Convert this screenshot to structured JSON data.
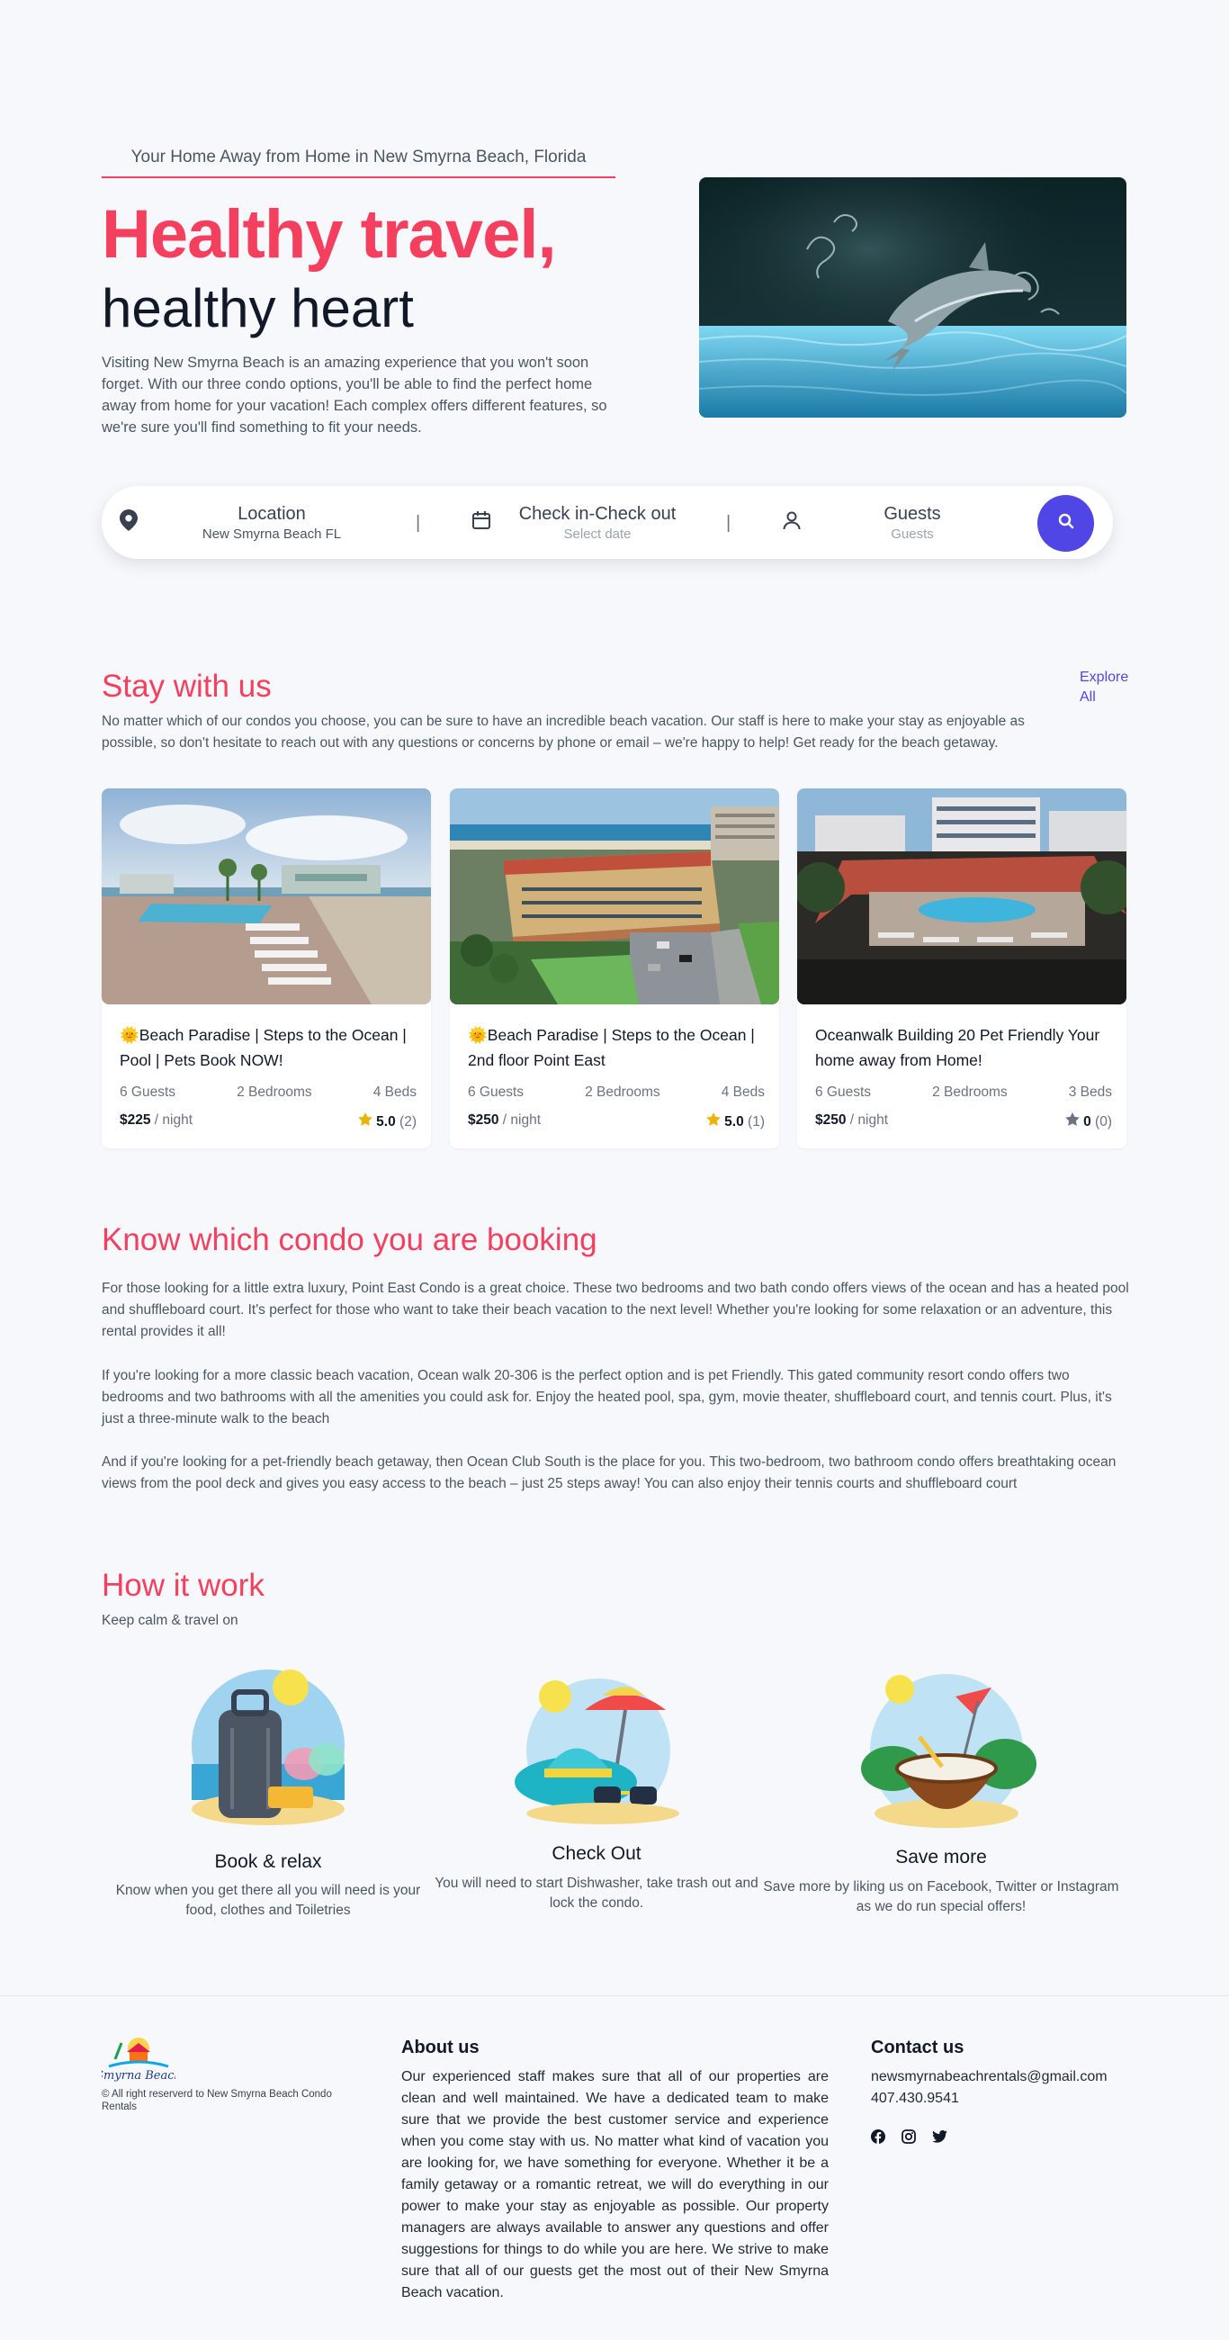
{
  "hero": {
    "tagline": "Your Home Away from Home in New Smyrna Beach, Florida",
    "title_line1": "Healthy travel,",
    "title_line2": "healthy heart",
    "description": "Visiting New Smyrna Beach is an amazing experience that you won't soon forget. With our three condo options, you'll be able to find the perfect home away from home for your vacation! Each complex offers different features, so we're sure you'll find something to fit your needs."
  },
  "search": {
    "location_label": "Location",
    "location_value": "New Smyrna Beach FL",
    "dates_label": "Check in-Check out",
    "dates_placeholder": "Select date",
    "guests_label": "Guests",
    "guests_placeholder": "Guests",
    "separator": "|"
  },
  "stay": {
    "title": "Stay with us",
    "description": "No matter which of our condos you choose, you can be sure to have an incredible beach vacation. Our staff is here to make your stay as enjoyable as possible, so don't hesitate to reach out with any questions or concerns by phone or email – we're happy to help! Get ready for the beach getaway.",
    "explore_link": "Explore All"
  },
  "listings": [
    {
      "title": "🌞Beach Paradise | Steps to the Ocean | Pool | Pets Book NOW!",
      "guests": "6 Guests",
      "bedrooms": "2 Bedrooms",
      "beds": "4 Beds",
      "price": "$225",
      "per": " / night",
      "rating": "5.0",
      "reviews": "(2)",
      "star_color": "#eab308"
    },
    {
      "title": "🌞Beach Paradise | Steps to the Ocean | 2nd floor Point East",
      "guests": "6 Guests",
      "bedrooms": "2 Bedrooms",
      "beds": "4 Beds",
      "price": "$250",
      "per": " / night",
      "rating": "5.0",
      "reviews": "(1)",
      "star_color": "#eab308"
    },
    {
      "title": "Oceanwalk Building 20 Pet Friendly Your home away from Home!",
      "guests": "6 Guests",
      "bedrooms": "2 Bedrooms",
      "beds": "3 Beds",
      "price": "$250",
      "per": " / night",
      "rating": "0",
      "reviews": "(0)",
      "star_color": "#6b7280"
    }
  ],
  "know": {
    "title": "Know which condo you are booking",
    "p1": "For those looking for a little extra luxury, Point East Condo is a great choice. These two bedrooms and two bath condo offers views of the ocean and has a heated pool and shuffleboard court. It's perfect for those who want to take their beach vacation to the next level! Whether you're looking for some relaxation or an adventure, this rental provides it all!",
    "p2": "If you're looking for a more classic beach vacation, Ocean walk 20-306 is the perfect option and is pet Friendly. This gated community resort condo offers two bedrooms and two bathrooms with all the amenities you could ask for. Enjoy the heated pool, spa, gym, movie theater, shuffleboard court, and tennis court. Plus, it's just a three-minute walk to the beach",
    "p3": "And if you're looking for a pet-friendly beach getaway, then Ocean Club South is the place for you. This two-bedroom, two bathroom condo offers breathtaking ocean views from the pool deck and gives you easy access to the beach – just 25 steps away! You can also enjoy their tennis courts and shuffleboard court"
  },
  "how": {
    "title": "How it work",
    "subtitle": "Keep calm & travel on",
    "steps": [
      {
        "title": "Book & relax",
        "text": "Know when you get there all you will need is your food, clothes and Toiletries"
      },
      {
        "title": "Check Out",
        "text": "You will need to start Dishwasher, take trash out and lock the condo."
      },
      {
        "title": "Save more",
        "text": "Save more by liking us on Facebook, Twitter or Instagram as we do run special offers!"
      }
    ]
  },
  "footer": {
    "logo_text": "Smyrna Beach",
    "copyright": "© All right reserverd to New Smyrna Beach Condo Rentals",
    "about_title": "About us",
    "about_text": "Our experienced staff makes sure that all of our properties are clean and well maintained. We have a dedicated team to make sure that we provide the best customer service and experience when you come stay with us. No matter what kind of vacation you are looking for, we have something for everyone. Whether it be a family getaway or a romantic retreat, we will do everything in our power to make your stay as enjoyable as possible. Our property managers are always available to answer any questions and offer suggestions for things to do while you are here. We strive to make sure that all of our guests get the most out of their New Smyrna Beach vacation.",
    "contact_title": "Contact us",
    "email": "newsmyrnabeachrentals@gmail.com",
    "phone": "407.430.9541"
  },
  "colors": {
    "accent": "#f43f5e",
    "primary": "#4f46e5",
    "star": "#eab308"
  },
  "icons": [
    "location-pin-icon",
    "calendar-icon",
    "user-icon",
    "search-icon",
    "star-icon",
    "facebook-icon",
    "instagram-icon",
    "twitter-icon"
  ]
}
